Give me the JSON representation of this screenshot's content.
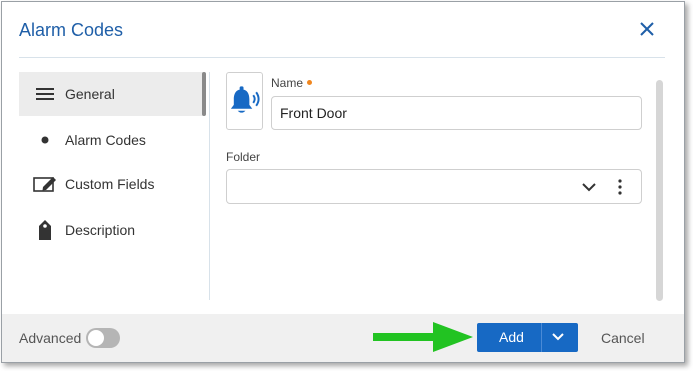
{
  "dialog": {
    "title": "Alarm Codes"
  },
  "sidebar": {
    "items": [
      {
        "label": "General",
        "icon": "hamburger-icon",
        "active": true
      },
      {
        "label": "Alarm Codes",
        "icon": "bullet-icon",
        "active": false
      },
      {
        "label": "Custom Fields",
        "icon": "edit-field-icon",
        "active": false
      },
      {
        "label": "Description",
        "icon": "tag-icon",
        "active": false
      }
    ]
  },
  "form": {
    "name_label": "Name",
    "name_value": "Front Door",
    "folder_label": "Folder",
    "folder_value": "",
    "record_icon": "alarm-bell-icon"
  },
  "footer": {
    "advanced_label": "Advanced",
    "advanced_on": false,
    "add_label": "Add",
    "cancel_label": "Cancel"
  },
  "colors": {
    "accent": "#1769c4",
    "title": "#1f5fa8",
    "required": "#f0861e",
    "annotation_arrow": "#22c322"
  }
}
